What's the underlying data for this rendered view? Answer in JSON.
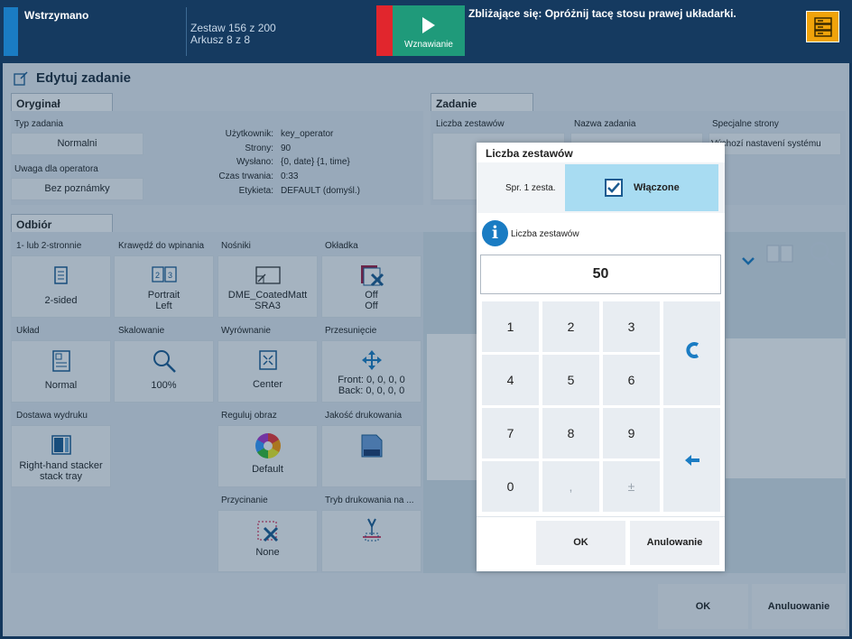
{
  "topbar": {
    "status": "Wstrzymano",
    "set_info": "Zestaw 156 z 200",
    "sheet_info": "Arkusz 8 z 8",
    "resume_label": "Wznawianie",
    "message": "Zbliżające się: Opróżnij tacę stosu prawej układarki."
  },
  "window": {
    "title": "Edytuj zadanie"
  },
  "original": {
    "tab": "Oryginał",
    "job_type_label": "Typ zadania",
    "job_type_value": "Normalni",
    "operator_note_label": "Uwaga dla operatora",
    "operator_note_value": "Bez poznámky",
    "info_labels": [
      "Użytkownik:",
      "Strony:",
      "Wysłano:",
      "Czas trwania:",
      "Etykieta:"
    ],
    "info_values": [
      "key_operator",
      "90",
      "{0, date} {1, time}",
      "0:33",
      "DEFAULT (domyśl.)"
    ]
  },
  "job": {
    "tab": "Zadanie",
    "sets_label": "Liczba zestawów",
    "name_label": "Nazwa zadania",
    "special_label": "Specjalne strony",
    "special_value": "Výchozí nastavení systému"
  },
  "output": {
    "tab": "Odbiór",
    "tiles": [
      {
        "label": "1- lub 2-stronnie",
        "value": "2-sided",
        "icon": "duplex-icon"
      },
      {
        "label": "Krawędź do wpinania",
        "value": "Portrait\nLeft",
        "icon": "binding-edge-icon"
      },
      {
        "label": "Nośniki",
        "value": "DME_CoatedMatt\nSRA3",
        "icon": "media-icon"
      },
      {
        "label": "Okładka",
        "value": "Off\nOff",
        "icon": "cover-icon"
      },
      {
        "label": "Układ",
        "value": "Normal",
        "icon": "layout-icon"
      },
      {
        "label": "Skalowanie",
        "value": "100%",
        "icon": "zoom-icon"
      },
      {
        "label": "Wyrównanie",
        "value": "Center",
        "icon": "alignment-icon"
      },
      {
        "label": "Przesunięcie",
        "value": "Front: 0, 0, 0, 0\nBack: 0, 0, 0, 0",
        "icon": "shift-icon"
      },
      {
        "label": "Dostawa wydruku",
        "value": "Right-hand stacker\nstack tray",
        "icon": "stacker-icon"
      },
      {
        "label": "Reguluj obraz",
        "value": "Default",
        "icon": "color-wheel-icon"
      },
      {
        "label": "Jakość drukowania",
        "value": "",
        "icon": "print-quality-icon"
      },
      {
        "label": "Przycinanie",
        "value": "None",
        "icon": "trim-icon"
      },
      {
        "label": "Tryb drukowania na ...",
        "value": "",
        "icon": "print-mode-icon"
      }
    ]
  },
  "footer": {
    "ok": "OK",
    "cancel": "Anuluowanie"
  },
  "dialog": {
    "title": "Liczba zestawów",
    "check_label": "Spr. 1 zesta.",
    "toggle_label": "Włączone",
    "info_label": "Liczba zestawów",
    "value": "50",
    "keys": [
      "1",
      "2",
      "3",
      "4",
      "5",
      "6",
      "7",
      "8",
      "9",
      "0",
      ",",
      "±"
    ],
    "ok": "OK",
    "cancel": "Anulowanie"
  },
  "colors": {
    "accent": "#1a7cc3",
    "resume": "#1f9a7a",
    "stop": "#e1262d",
    "highlight": "#a8dcf2"
  }
}
